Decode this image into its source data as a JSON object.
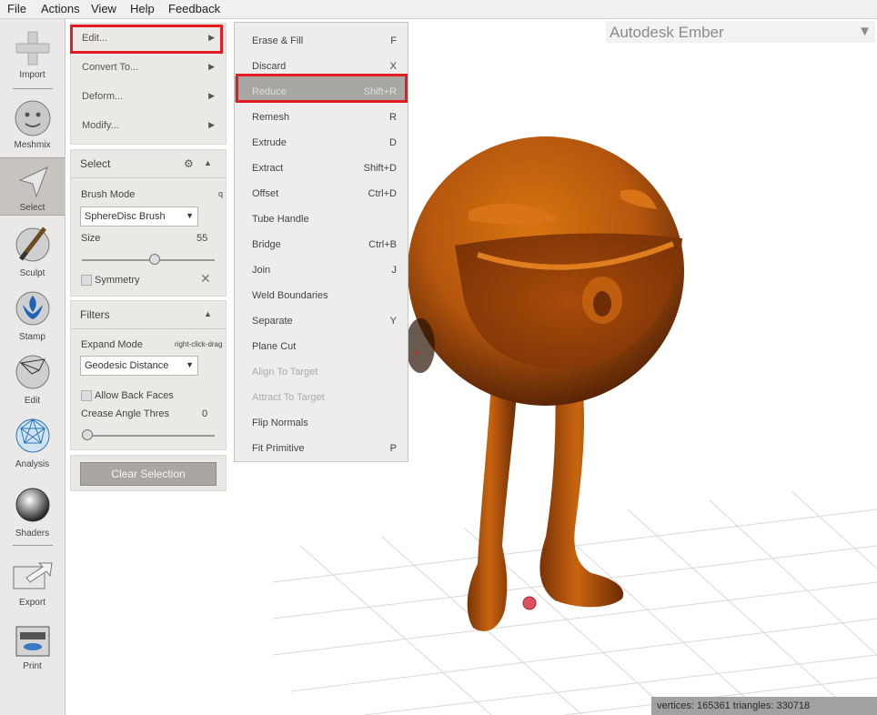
{
  "menubar": {
    "items": [
      "File",
      "Actions",
      "View",
      "Help",
      "Feedback"
    ]
  },
  "toolbar": {
    "tools": [
      {
        "label": "Import",
        "icon": "plus-icon"
      },
      {
        "label": "Meshmix",
        "icon": "face-sphere-icon"
      },
      {
        "label": "Select",
        "icon": "arrow-cursor-icon"
      },
      {
        "label": "Sculpt",
        "icon": "brush-sphere-icon"
      },
      {
        "label": "Stamp",
        "icon": "fleur-de-lis-sphere-icon"
      },
      {
        "label": "Edit",
        "icon": "wireframe-sphere-icon"
      },
      {
        "label": "Analysis",
        "icon": "geodesic-sphere-icon"
      },
      {
        "label": "Shaders",
        "icon": "chrome-sphere-icon"
      },
      {
        "label": "Export",
        "icon": "export-arrow-icon"
      },
      {
        "label": "Print",
        "icon": "printer-icon"
      }
    ],
    "active": "Select"
  },
  "action_menu": {
    "items": [
      "Edit...",
      "Convert To...",
      "Deform...",
      "Modify..."
    ]
  },
  "select_panel": {
    "title": "Select",
    "brush_mode_label": "Brush Mode",
    "brush_mode_hotkey": "q",
    "brush_mode_value": "SphereDisc Brush",
    "size_label": "Size",
    "size_value": "55",
    "size_fraction": 0.55,
    "symmetry_label": "Symmetry"
  },
  "filters_panel": {
    "title": "Filters",
    "expand_mode_label": "Expand Mode",
    "expand_mode_hint": "right-click-drag",
    "expand_mode_value": "Geodesic Distance",
    "allow_back_faces_label": "Allow Back Faces",
    "crease_label": "Crease Angle Thres",
    "crease_value": "0",
    "crease_fraction": 0
  },
  "clear_selection_label": "Clear Selection",
  "edit_submenu": {
    "items": [
      {
        "label": "Erase & Fill",
        "key": "F"
      },
      {
        "label": "Discard",
        "key": "X"
      },
      {
        "label": "Reduce",
        "key": "Shift+R"
      },
      {
        "label": "Remesh",
        "key": "R"
      },
      {
        "label": "Extrude",
        "key": "D"
      },
      {
        "label": "Extract",
        "key": "Shift+D"
      },
      {
        "label": "Offset",
        "key": "Ctrl+D"
      },
      {
        "label": "Tube Handle",
        "key": ""
      },
      {
        "label": "Bridge",
        "key": "Ctrl+B"
      },
      {
        "label": "Join",
        "key": "J"
      },
      {
        "label": "Weld Boundaries",
        "key": ""
      },
      {
        "label": "Separate",
        "key": "Y"
      },
      {
        "label": "Plane Cut",
        "key": ""
      },
      {
        "label": "Align To Target",
        "key": ""
      },
      {
        "label": "Attract To Target",
        "key": ""
      },
      {
        "label": "Flip Normals",
        "key": ""
      },
      {
        "label": "Fit Primitive",
        "key": "P"
      }
    ],
    "highlighted": "Reduce",
    "disabled": [
      "Align To Target",
      "Attract To Target"
    ]
  },
  "workspace": {
    "name": "Autodesk Ember"
  },
  "status": {
    "text": "vertices: 165361 triangles: 330718"
  },
  "colors": {
    "model": "#b5560e",
    "highlight_box": "#e21c22",
    "panel_bg": "#ebe9e6"
  }
}
